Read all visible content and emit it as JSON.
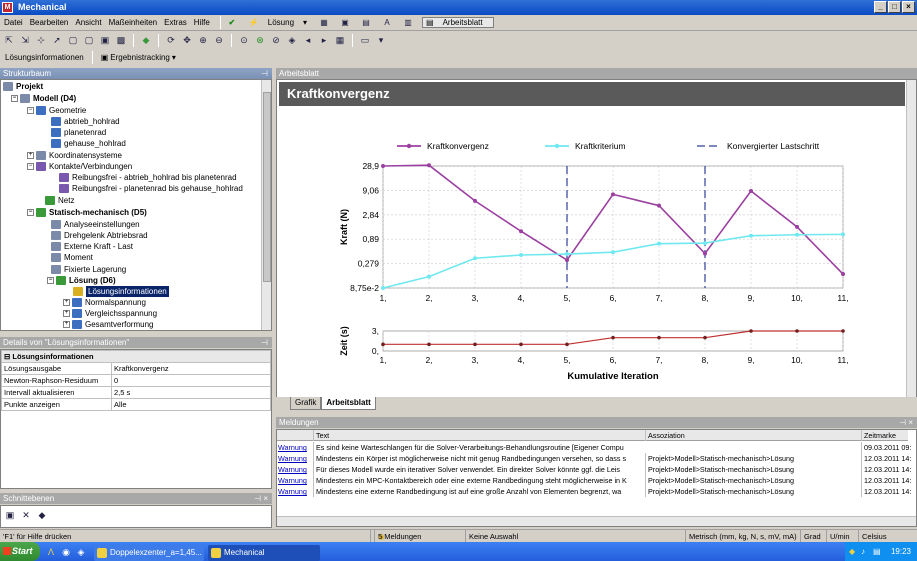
{
  "app": {
    "title": "Mechanical"
  },
  "menu": [
    "Datei",
    "Bearbeiten",
    "Ansicht",
    "Maßeinheiten",
    "Extras",
    "Hilfe"
  ],
  "toolbar1": {
    "solve_label": "Lösung",
    "worksheet_label": "Arbeitsblatt"
  },
  "toolbar3": {
    "info_label": "Lösungsinformationen",
    "tracking_label": "Ergebnistracking"
  },
  "tree": {
    "title": "Strukturbaum",
    "items": [
      {
        "label": "Projekt",
        "bold": true
      },
      {
        "label": "Modell (D4)",
        "bold": true
      },
      {
        "label": "Geometrie"
      },
      {
        "label": "abtrieb_hohlrad"
      },
      {
        "label": "planetenrad"
      },
      {
        "label": "gehause_hohlrad"
      },
      {
        "label": "Koordinatensysteme"
      },
      {
        "label": "Kontakte/Verbindungen"
      },
      {
        "label": "Reibungsfrei - abtrieb_hohlrad bis planetenrad"
      },
      {
        "label": "Reibungsfrei - planetenrad bis gehause_hohlrad"
      },
      {
        "label": "Netz"
      },
      {
        "label": "Statisch-mechanisch (D5)",
        "bold": true
      },
      {
        "label": "Analyseeinstellungen"
      },
      {
        "label": "Drehgelenk Abtriebsrad"
      },
      {
        "label": "Externe Kraft - Last"
      },
      {
        "label": "Moment"
      },
      {
        "label": "Fixierte Lagerung"
      },
      {
        "label": "Lösung (D6)",
        "bold": true
      },
      {
        "label": "Lösungsinformationen"
      },
      {
        "label": "Normalspannung"
      },
      {
        "label": "Vergleichsspannung"
      },
      {
        "label": "Gesamtverformung"
      }
    ]
  },
  "details": {
    "title": "Details von \"Lösungsinformationen\"",
    "section": "Lösungsinformationen",
    "rows": [
      {
        "key": "Lösungsausgabe",
        "value": "Kraftkonvergenz"
      },
      {
        "key": "Newton-Raphson-Residuum",
        "value": "0"
      },
      {
        "key": "Intervall aktualisieren",
        "value": "2,5 s"
      },
      {
        "key": "Punkte anzeigen",
        "value": "Alle"
      }
    ]
  },
  "sections_panel": {
    "title": "Schnittebenen"
  },
  "worksheet": {
    "panel_title": "Arbeitsblatt",
    "heading": "Kraftkonvergenz",
    "tabs": [
      "Grafik",
      "Arbeitsblatt"
    ]
  },
  "chart_data": [
    {
      "type": "line",
      "ylabel": "Kraft (N)",
      "yscale": "log",
      "yticks": [
        "28,9",
        "9,06",
        "2,84",
        "0,89",
        "0,279",
        "8,75e-2"
      ],
      "ytick_values": [
        28.9,
        9.06,
        2.84,
        0.89,
        0.279,
        0.0875
      ],
      "ylim": [
        0.0875,
        28.9
      ],
      "xticks": [
        "1,",
        "2,",
        "3,",
        "4,",
        "5,",
        "6,",
        "7,",
        "8,",
        "9,",
        "10,",
        "11,"
      ],
      "x": [
        1,
        2,
        3,
        4,
        5,
        6,
        7,
        8,
        9,
        10,
        11
      ],
      "legend_position": "top",
      "series": [
        {
          "name": "Kraftkonvergenz",
          "color": "#9b3fa0",
          "values": [
            28.9,
            30.0,
            5.5,
            1.3,
            0.33,
            7.5,
            4.4,
            0.45,
            8.8,
            1.6,
            0.17
          ]
        },
        {
          "name": "Kraftkriterium",
          "color": "#6fe8f0",
          "values": [
            0.0875,
            0.15,
            0.36,
            0.42,
            0.44,
            0.48,
            0.72,
            0.74,
            1.05,
            1.1,
            1.12
          ]
        }
      ],
      "vlines": {
        "name": "Konvergierter Lastschritt",
        "color": "#30409a",
        "x": [
          5,
          8
        ]
      }
    },
    {
      "type": "line",
      "ylabel": "Zeit (s)",
      "xlabel": "Kumulative Iteration",
      "yticks": [
        "3,",
        "0,"
      ],
      "ytick_values": [
        3,
        0
      ],
      "ylim": [
        0,
        3
      ],
      "xticks": [
        "1,",
        "2,",
        "3,",
        "4,",
        "5,",
        "6,",
        "7,",
        "8,",
        "9,",
        "10,",
        "11,"
      ],
      "x": [
        1,
        2,
        3,
        4,
        5,
        6,
        7,
        8,
        9,
        10,
        11
      ],
      "series": [
        {
          "color": "#c03030",
          "values": [
            1,
            1,
            1,
            1,
            1,
            2,
            2,
            2,
            3,
            3,
            3
          ]
        }
      ]
    }
  ],
  "messages": {
    "title": "Meldungen",
    "columns": [
      "Text",
      "Assoziation",
      "Zeitmarke"
    ],
    "rows": [
      {
        "type": "Warnung",
        "text": "Es sind keine Warteschlangen für die Solver-Verarbeitungs-Behandlungsroutine [Eigener Compu",
        "assoc": "",
        "time": "09.03.2011 09:"
      },
      {
        "type": "Warnung",
        "text": "Mindestens ein Körper ist möglicherweise nicht mit genug Randbedingungen versehen, so dass s",
        "assoc": "Projekt>Modell>Statisch-mechanisch>Lösung",
        "time": "12.03.2011 14:"
      },
      {
        "type": "Warnung",
        "text": "Für dieses Modell wurde ein iterativer Solver verwendet.  Ein direkter Solver könnte ggf. die Leis",
        "assoc": "Projekt>Modell>Statisch-mechanisch>Lösung",
        "time": "12.03.2011 14:"
      },
      {
        "type": "Warnung",
        "text": "Mindestens ein MPC-Kontaktbereich oder eine externe Randbedingung steht möglicherweise in K",
        "assoc": "Projekt>Modell>Statisch-mechanisch>Lösung",
        "time": "12.03.2011 14:"
      },
      {
        "type": "Warnung",
        "text": "Mindestens eine externe Randbedingung ist auf eine große Anzahl von Elementen begrenzt, wa",
        "assoc": "Projekt>Modell>Statisch-mechanisch>Lösung",
        "time": "12.03.2011 14:"
      }
    ]
  },
  "status": {
    "help": "'F1' für Hilfe drücken",
    "messages": "5 Meldungen",
    "selection": "Keine Auswahl",
    "units": "Metrisch (mm, kg, N, s, mV, mA)",
    "deg": "Grad",
    "rpm": "U/min",
    "temp": "Celsius"
  },
  "taskbar": {
    "start": "Start",
    "task1": "Doppelexzenter_a=1,45...",
    "task2": "Mechanical",
    "clock": "19:23"
  }
}
